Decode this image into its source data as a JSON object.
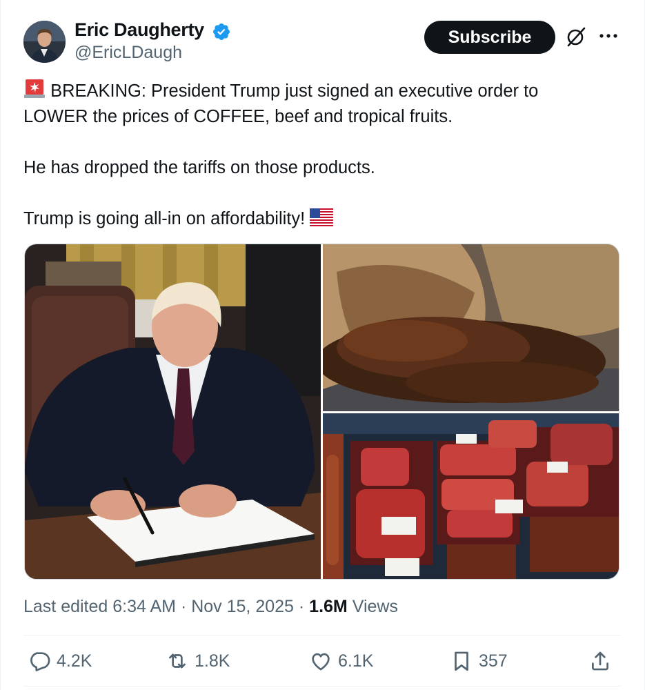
{
  "author": {
    "name": "Eric Daugherty",
    "handle": "@EricLDaugh",
    "verified": true,
    "avatar": "avatar"
  },
  "header": {
    "subscribe_label": "Subscribe",
    "grok_icon": "grok-icon",
    "more_icon": "more-icon"
  },
  "post": {
    "line1": "BREAKING: President Trump just signed an executive order to",
    "line2": "LOWER the prices of COFFEE, beef and tropical fruits.",
    "line3": "He has dropped the tariffs on those products.",
    "line4": "Trump is going all-in on affordability!",
    "lead_emoji": "rotating-light-emoji",
    "trail_emoji": "us-flag-emoji"
  },
  "media": {
    "image_left": "photo of man signing document at desk",
    "image_top_right": "photo of coffee beans spilling from burlap sack",
    "image_bottom_right": "photo of beef cuts in butcher display case"
  },
  "meta": {
    "edited": "Last edited 6:34 AM",
    "sep": "·",
    "date": "Nov 15, 2025",
    "views_count": "1.6M",
    "views_label": "Views"
  },
  "actions": {
    "replies": "4.2K",
    "reposts": "1.8K",
    "likes": "6.1K",
    "bookmarks": "357"
  },
  "colors": {
    "text": "#0f1419",
    "secondary": "#536471",
    "verified": "#1d9bf0",
    "border": "#cfd9de"
  }
}
